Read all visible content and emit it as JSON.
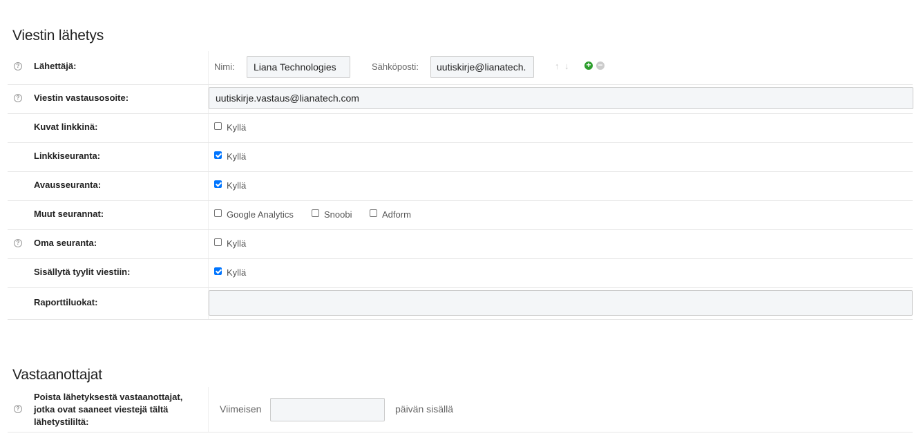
{
  "sending": {
    "title": "Viestin lähetys",
    "sender": {
      "label": "Lähettäjä:",
      "name_label": "Nimi:",
      "name_value": "Liana Technologies",
      "email_label": "Sähköposti:",
      "email_value": "uutiskirje@lianatech."
    },
    "reply_to": {
      "label": "Viestin vastausosoite:",
      "value": "uutiskirje.vastaus@lianatech.com"
    },
    "images_as_links": {
      "label": "Kuvat linkkinä:",
      "option": "Kyllä",
      "checked": false
    },
    "link_tracking": {
      "label": "Linkkiseuranta:",
      "option": "Kyllä",
      "checked": true
    },
    "open_tracking": {
      "label": "Avausseuranta:",
      "option": "Kyllä",
      "checked": true
    },
    "other_tracking": {
      "label": "Muut seurannat:",
      "options": [
        {
          "label": "Google Analytics",
          "checked": false
        },
        {
          "label": "Snoobi",
          "checked": false
        },
        {
          "label": "Adform",
          "checked": false
        }
      ]
    },
    "own_tracking": {
      "label": "Oma seuranta:",
      "option": "Kyllä",
      "checked": false
    },
    "include_styles": {
      "label": "Sisällytä tyylit viestiin:",
      "option": "Kyllä",
      "checked": true
    },
    "report_classes": {
      "label": "Raporttiluokat:",
      "value": ""
    }
  },
  "recipients": {
    "title": "Vastaanottajat",
    "remove_recent": {
      "label_line1": "Poista lähetyksestä vastaanottajat,",
      "label_line2": "jotka ovat saaneet viestejä tältä",
      "label_line3": "lähetystililtä:",
      "prefix": "Viimeisen",
      "value": "",
      "suffix": "päivän sisällä"
    }
  },
  "colors": {
    "checkbox_checked": "#0075ff",
    "add_icon": "#2e9e2e",
    "remove_icon": "#cccccc"
  }
}
